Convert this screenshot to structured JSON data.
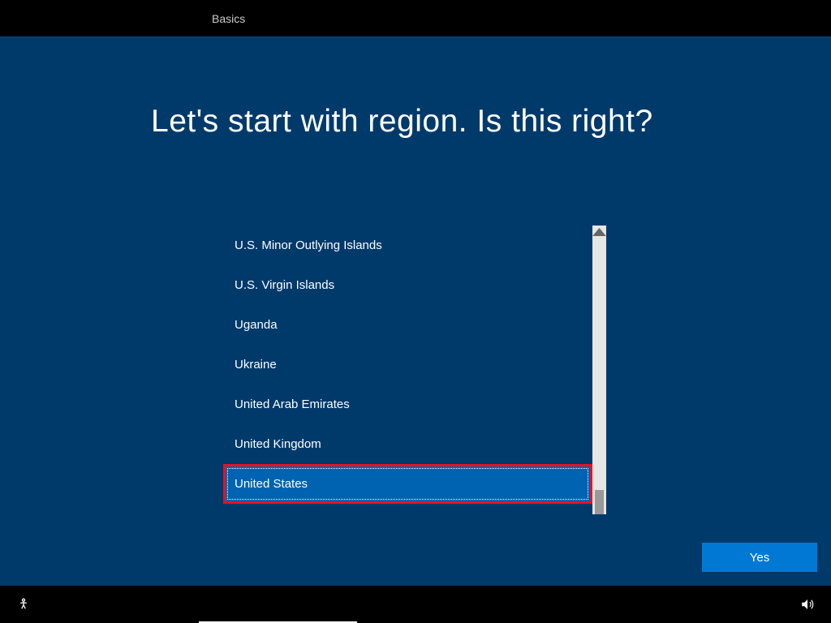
{
  "tabs": {
    "active": "Basics"
  },
  "heading": "Let's start with region. Is this right?",
  "regions": [
    {
      "label": "U.S. Minor Outlying Islands",
      "selected": false
    },
    {
      "label": "U.S. Virgin Islands",
      "selected": false
    },
    {
      "label": "Uganda",
      "selected": false
    },
    {
      "label": "Ukraine",
      "selected": false
    },
    {
      "label": "United Arab Emirates",
      "selected": false
    },
    {
      "label": "United Kingdom",
      "selected": false
    },
    {
      "label": "United States",
      "selected": true
    }
  ],
  "buttons": {
    "yes": "Yes"
  }
}
